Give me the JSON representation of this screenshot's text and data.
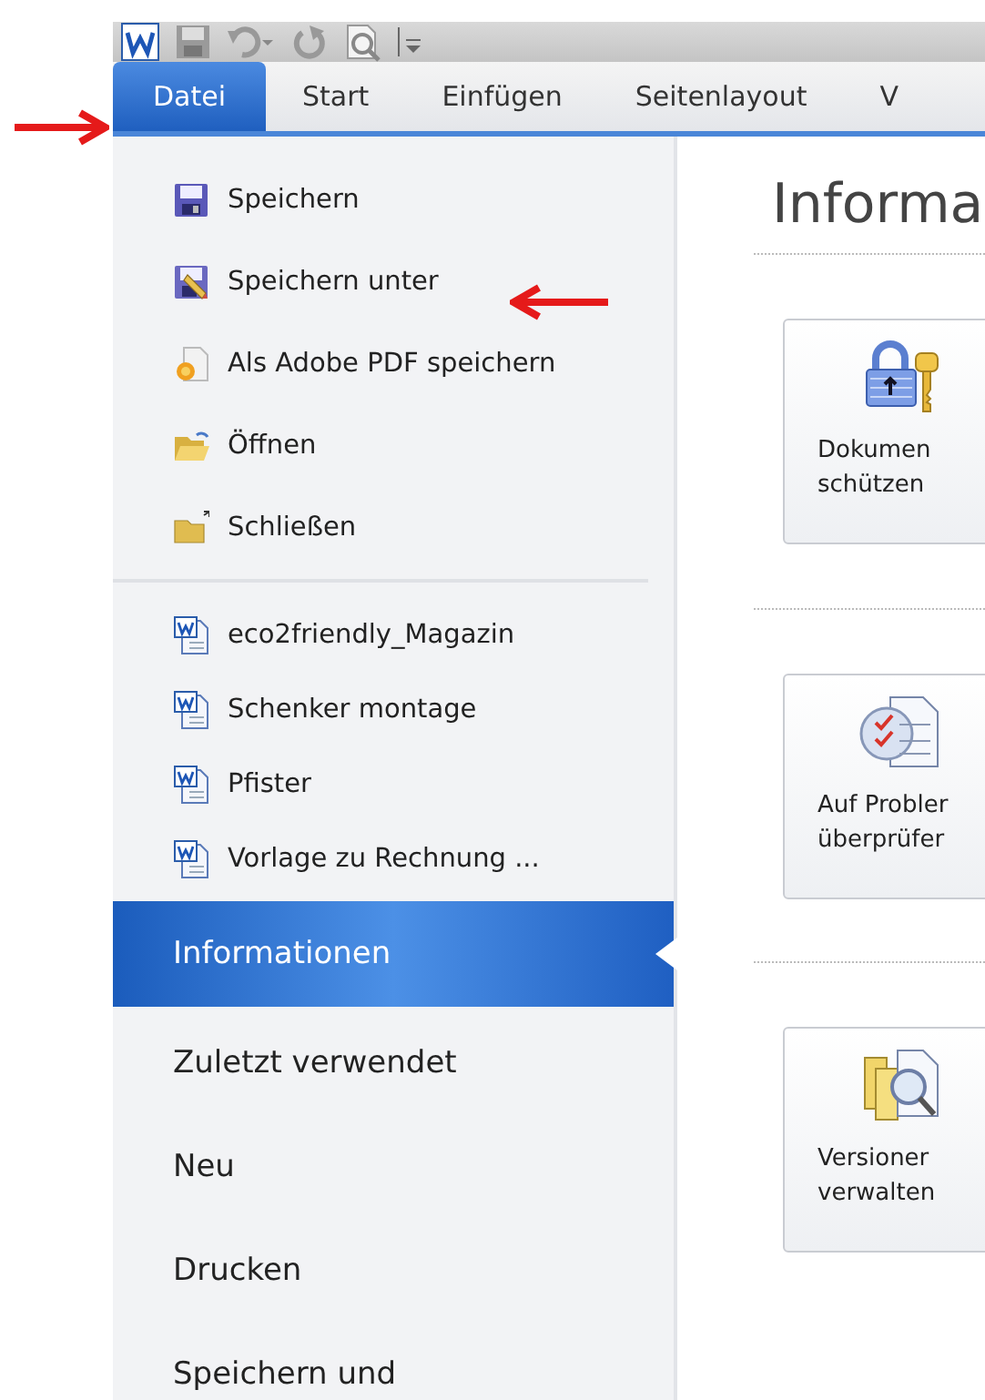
{
  "tabs": [
    {
      "label": "Datei",
      "selected": true
    },
    {
      "label": "Start",
      "selected": false
    },
    {
      "label": "Einfügen",
      "selected": false
    },
    {
      "label": "Seitenlayout",
      "selected": false
    },
    {
      "label": "V",
      "selected": false
    }
  ],
  "commands": [
    {
      "label": "Speichern"
    },
    {
      "label": "Speichern unter"
    },
    {
      "label": "Als Adobe PDF speichern"
    },
    {
      "label": "Öffnen"
    },
    {
      "label": "Schließen"
    }
  ],
  "recent_documents": [
    {
      "label": "eco2friendly_Magazin"
    },
    {
      "label": "Schenker montage"
    },
    {
      "label": "Pfister"
    },
    {
      "label": "Vorlage zu Rechnung ..."
    }
  ],
  "nav": [
    {
      "label": "Informationen",
      "selected": true
    },
    {
      "label": "Zuletzt verwendet",
      "selected": false
    },
    {
      "label": "Neu",
      "selected": false
    },
    {
      "label": "Drucken",
      "selected": false
    },
    {
      "label": "Speichern und",
      "selected": false
    }
  ],
  "page_title": "Informa",
  "actions": [
    {
      "lines": [
        "Dokumen",
        "schützen"
      ]
    },
    {
      "lines": [
        "Auf Probler",
        "überprüfer"
      ]
    },
    {
      "lines": [
        "Versioner",
        "verwalten"
      ]
    }
  ]
}
